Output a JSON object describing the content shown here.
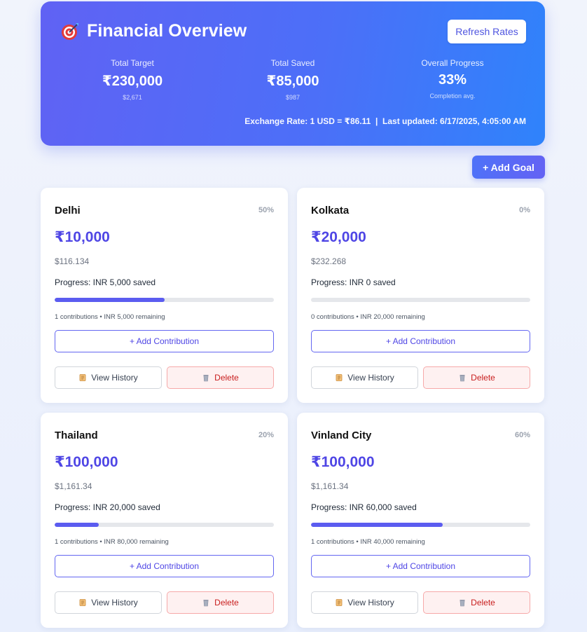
{
  "header": {
    "title": "Financial Overview",
    "icon": "target-icon",
    "refresh_label": "Refresh Rates",
    "stats": [
      {
        "label": "Total Target",
        "value": "₹230,000",
        "sub": "$2,671"
      },
      {
        "label": "Total Saved",
        "value": "₹85,000",
        "sub": "$987"
      },
      {
        "label": "Overall Progress",
        "value": "33%",
        "sub": "Completion avg."
      }
    ],
    "exchange": "Exchange Rate: 1 USD = ₹86.11  |  Last updated: 6/17/2025, 4:05:00 AM"
  },
  "add_goal_label": "+ Add Goal",
  "goals": [
    {
      "name": "Delhi",
      "percent_label": "50%",
      "progress": 0.5,
      "amount": "₹10,000",
      "usd": "$116.134",
      "progress_text": "Progress: INR 5,000 saved",
      "meta": "1 contributions • INR 5,000 remaining",
      "contrib_label": "+ Add Contribution",
      "history_label": "View History",
      "delete_label": "Delete"
    },
    {
      "name": "Kolkata",
      "percent_label": "0%",
      "progress": 0.0,
      "amount": "₹20,000",
      "usd": "$232.268",
      "progress_text": "Progress: INR 0 saved",
      "meta": "0 contributions • INR 20,000 remaining",
      "contrib_label": "+ Add Contribution",
      "history_label": "View History",
      "delete_label": "Delete"
    },
    {
      "name": "Thailand",
      "percent_label": "20%",
      "progress": 0.2,
      "amount": "₹100,000",
      "usd": "$1,161.34",
      "progress_text": "Progress: INR 20,000 saved",
      "meta": "1 contributions • INR 80,000 remaining",
      "contrib_label": "+ Add Contribution",
      "history_label": "View History",
      "delete_label": "Delete"
    },
    {
      "name": "Vinland City",
      "percent_label": "60%",
      "progress": 0.6,
      "amount": "₹100,000",
      "usd": "$1,161.34",
      "progress_text": "Progress: INR 60,000 saved",
      "meta": "1 contributions • INR 40,000 remaining",
      "contrib_label": "+ Add Contribution",
      "history_label": "View History",
      "delete_label": "Delete"
    }
  ],
  "colors": {
    "accent": "#4f46e5",
    "progress_fill": "#5b5cf0",
    "delete": "#c81e1e"
  },
  "icons": {
    "history": "scroll-icon",
    "delete": "wastebasket-icon"
  }
}
